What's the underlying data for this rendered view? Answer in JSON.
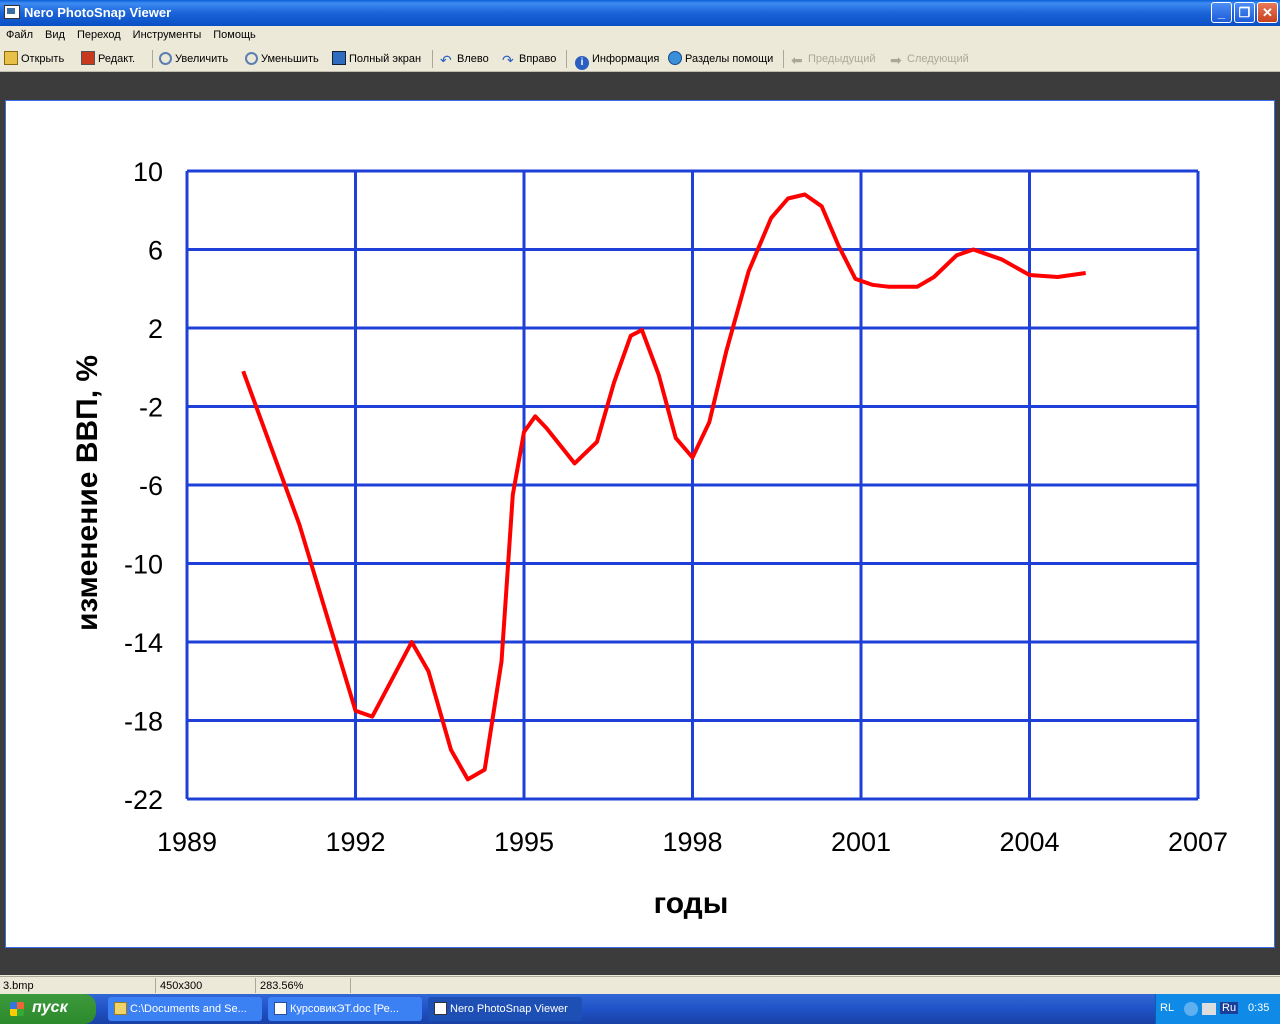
{
  "window": {
    "title": "Nero PhotoSnap Viewer"
  },
  "menu": [
    "Файл",
    "Вид",
    "Переход",
    "Инструменты",
    "Помощь"
  ],
  "toolbar": {
    "open": "Открыть",
    "edit": "Редакт.",
    "zoom_in": "Увеличить",
    "zoom_out": "Уменьшить",
    "fullscreen": "Полный экран",
    "left": "Влево",
    "right": "Вправо",
    "info": "Информация",
    "help": "Разделы помощи",
    "prev": "Предыдущий",
    "next": "Следующий"
  },
  "status": {
    "file": "3.bmp",
    "dims": "450x300",
    "zoom": "283.56%"
  },
  "taskbar": {
    "start": "пуск",
    "tasks": [
      "C:\\Documents and Se...",
      "КурсовикЭТ.doc [Ре...",
      "Nero PhotoSnap Viewer"
    ],
    "tray_lang": "RL",
    "tray_ru": "Ru",
    "clock": "0:35"
  },
  "colors": {
    "series": "#ff0000",
    "grid": "#1e3fd8"
  },
  "chart_data": {
    "type": "line",
    "xlabel": "годы",
    "ylabel": "изменение ВВП, %",
    "xlim": [
      1989,
      2007
    ],
    "ylim": [
      -22,
      10
    ],
    "xticks": [
      "1989",
      "1992",
      "1995",
      "1998",
      "2001",
      "2004",
      "2007"
    ],
    "yticks": [
      "10",
      "6",
      "2",
      "-2",
      "-6",
      "-10",
      "-14",
      "-18",
      "-22"
    ],
    "grid": true,
    "series": [
      {
        "x": [
          1990.0,
          1991.0,
          1992.0,
          1992.3,
          1993.0,
          1993.3,
          1993.7,
          1994.0,
          1994.3,
          1994.6,
          1994.8,
          1995.0,
          1995.2,
          1995.4,
          1995.9,
          1996.3,
          1996.6,
          1996.9,
          1997.1,
          1997.4,
          1997.7,
          1998.0,
          1998.3,
          1998.6,
          1999.0,
          1999.4,
          1999.7,
          2000.0,
          2000.3,
          2000.6,
          2000.9,
          2001.2,
          2001.5,
          2002.0,
          2002.3,
          2002.7,
          2003.0,
          2003.5,
          2004.0,
          2004.5,
          2005.0
        ],
        "y": [
          -0.2,
          -8.0,
          -17.5,
          -17.8,
          -14.0,
          -15.5,
          -19.5,
          -21.0,
          -20.5,
          -15.0,
          -6.5,
          -3.3,
          -2.5,
          -3.1,
          -4.9,
          -3.8,
          -0.8,
          1.6,
          1.9,
          -0.4,
          -3.6,
          -4.6,
          -2.8,
          0.8,
          4.9,
          7.6,
          8.6,
          8.8,
          8.2,
          6.2,
          4.5,
          4.2,
          4.1,
          4.1,
          4.6,
          5.7,
          6.0,
          5.5,
          4.7,
          4.6,
          4.8
        ]
      }
    ]
  }
}
